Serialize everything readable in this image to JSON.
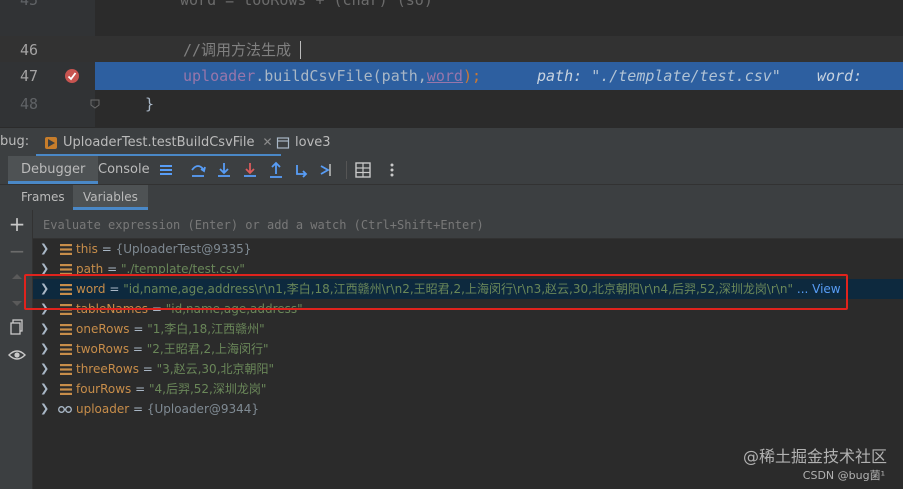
{
  "editor": {
    "lines": [
      {
        "num": "45",
        "code": ""
      },
      {
        "num": "46",
        "code": "//调用方法生成"
      },
      {
        "num": "47",
        "code_obj": "uploader",
        "code_call": ".buildCsvFile(path,",
        "code_arg": "word",
        "code_end": ");",
        "hint1_label": "path: ",
        "hint1_value": "\"./template/test.csv\"",
        "hint2_label": "word: "
      },
      {
        "num": "48",
        "code": "}"
      }
    ]
  },
  "debug": {
    "label": "bug:",
    "tabs": [
      {
        "label": "UploaderTest.testBuildCsvFile"
      },
      {
        "label": "love3"
      }
    ]
  },
  "toolbar": {
    "tabs": [
      {
        "label": "Debugger"
      },
      {
        "label": "Console"
      }
    ]
  },
  "subtabs": [
    {
      "label": "Frames"
    },
    {
      "label": "Variables"
    }
  ],
  "eval": {
    "placeholder": "Evaluate expression (Enter) or add a watch (Ctrl+Shift+Enter)"
  },
  "variables": [
    {
      "name": "this",
      "value": "{UploaderTest@9335}",
      "kind": "obj"
    },
    {
      "name": "path",
      "value": "\"./template/test.csv\"",
      "kind": "str"
    },
    {
      "name": "word",
      "value": "\"id,name,age,address\\r\\n1,李白,18,江西赣州\\r\\n2,王昭君,2,上海闵行\\r\\n3,赵云,30,北京朝阳\\r\\n4,后羿,52,深圳龙岗\\r\\n\"",
      "kind": "str",
      "more": "... View"
    },
    {
      "name": "tableNames",
      "value": "\"id,name,age,address\"",
      "kind": "str"
    },
    {
      "name": "oneRows",
      "value": "\"1,李白,18,江西赣州\"",
      "kind": "str"
    },
    {
      "name": "twoRows",
      "value": "\"2,王昭君,2,上海闵行\"",
      "kind": "str"
    },
    {
      "name": "threeRows",
      "value": "\"3,赵云,30,北京朝阳\"",
      "kind": "str"
    },
    {
      "name": "fourRows",
      "value": "\"4,后羿,52,深圳龙岗\"",
      "kind": "str"
    },
    {
      "name": "uploader",
      "value": "{Uploader@9344}",
      "kind": "obj"
    }
  ],
  "watermark": {
    "main": "@稀土掘金技术社区",
    "sub": "CSDN @bug菌¹"
  },
  "colors": {
    "exec_line": "#2d5fa0",
    "highlight_box": "#e0231d",
    "string": "#6a8759",
    "var_name": "#c78d4a"
  }
}
